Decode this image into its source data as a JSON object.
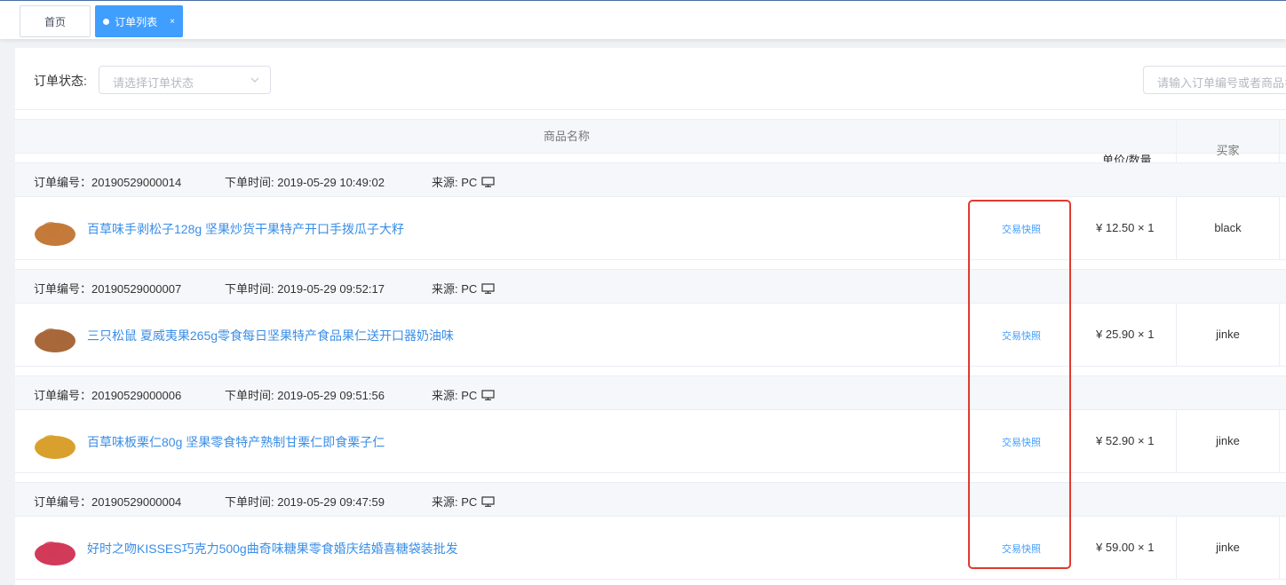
{
  "tabs": [
    {
      "label": "首页",
      "active": false
    },
    {
      "label": "订单列表",
      "active": true,
      "close": "×"
    }
  ],
  "filter": {
    "status_label": "订单状态:",
    "status_placeholder": "请选择订单状态",
    "search_placeholder": "请输入订单编号或者商品名称"
  },
  "table": {
    "col_name": "商品名称",
    "col_price": "单价/数量",
    "col_buyer": "买家"
  },
  "orders": [
    {
      "id_text": "订单编号：20190529000014",
      "time_text": "下单时间: 2019-05-29 10:49:02",
      "source_text": "来源: PC",
      "product": "百草味手剥松子128g 坚果炒货干果特产开口手拨瓜子大籽",
      "snapshot": "交易快照",
      "price": "¥ 12.50 × 1",
      "buyer": "black",
      "thumb_color": "#c47a3a"
    },
    {
      "id_text": "订单编号：20190529000007",
      "time_text": "下单时间: 2019-05-29 09:52:17",
      "source_text": "来源: PC",
      "product": "三只松鼠 夏威夷果265g零食每日坚果特产食品果仁送开口器奶油味",
      "snapshot": "交易快照",
      "price": "¥ 25.90 × 1",
      "buyer": "jinke",
      "thumb_color": "#a8683a"
    },
    {
      "id_text": "订单编号：20190529000006",
      "time_text": "下单时间: 2019-05-29 09:51:56",
      "source_text": "来源: PC",
      "product": "百草味板栗仁80g 坚果零食特产熟制甘栗仁即食栗子仁",
      "snapshot": "交易快照",
      "price": "¥ 52.90 × 1",
      "buyer": "jinke",
      "thumb_color": "#d9a02e"
    },
    {
      "id_text": "订单编号：20190529000004",
      "time_text": "下单时间: 2019-05-29 09:47:59",
      "source_text": "来源: PC",
      "product": "好时之吻KISSES巧克力500g曲奇味糖果零食婚庆结婚喜糖袋装批发",
      "snapshot": "交易快照",
      "price": "¥ 59.00 × 1",
      "buyer": "jinke",
      "thumb_color": "#d23a5a"
    }
  ]
}
